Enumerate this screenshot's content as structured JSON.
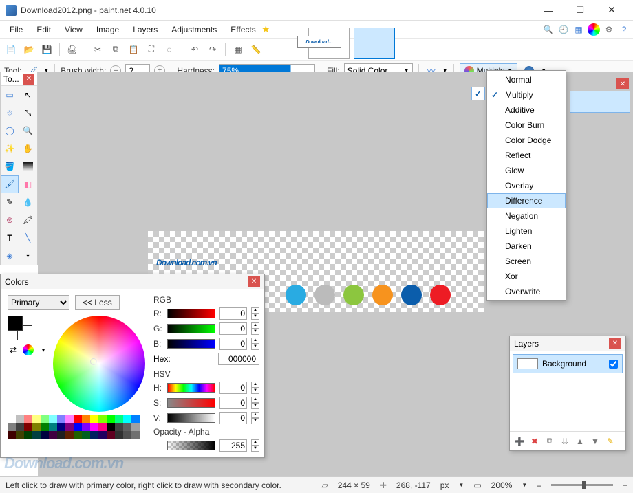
{
  "titlebar": {
    "title": "Download2012.png - paint.net 4.0.10"
  },
  "menu": {
    "items": [
      "File",
      "Edit",
      "View",
      "Image",
      "Layers",
      "Adjustments",
      "Effects"
    ]
  },
  "righticons": [
    "search-icon",
    "clock-icon",
    "layers-icon",
    "color-wheel-icon",
    "gear-icon",
    "help-icon"
  ],
  "toolopts": {
    "tool_label": "Tool:",
    "brush_width_label": "Brush width:",
    "brush_width_value": "2",
    "hardness_label": "Hardness:",
    "hardness_value": "75%",
    "fill_label": "Fill:",
    "fill_value": "Solid Color",
    "blend_label": "Multiply"
  },
  "blend_modes": [
    "Normal",
    "Multiply",
    "Additive",
    "Color Burn",
    "Color Dodge",
    "Reflect",
    "Glow",
    "Overlay",
    "Difference",
    "Negation",
    "Lighten",
    "Darken",
    "Screen",
    "Xor",
    "Overwrite"
  ],
  "blend_checked": "Multiply",
  "blend_hover": "Difference",
  "tools_panel": {
    "title": "To..."
  },
  "colors": {
    "title": "Colors",
    "mode": "Primary",
    "less_label": "<< Less",
    "rgb_label": "RGB",
    "r_label": "R:",
    "r_value": "0",
    "g_label": "G:",
    "g_value": "0",
    "b_label": "B:",
    "b_value": "0",
    "hex_label": "Hex:",
    "hex_value": "000000",
    "hsv_label": "HSV",
    "h_label": "H:",
    "h_value": "0",
    "s_label": "S:",
    "s_value": "0",
    "v_label": "V:",
    "v_value": "0",
    "opacity_label": "Opacity - Alpha",
    "opacity_value": "255"
  },
  "layers": {
    "title": "Layers",
    "item": "Background"
  },
  "status": {
    "hint": "Left click to draw with primary color, right click to draw with secondary color.",
    "size": "244 × 59",
    "cursor": "268, -117",
    "unit": "px",
    "zoom": "200%"
  },
  "canvas_logo": "Download.com.vn",
  "watermark": "Download.com.vn"
}
